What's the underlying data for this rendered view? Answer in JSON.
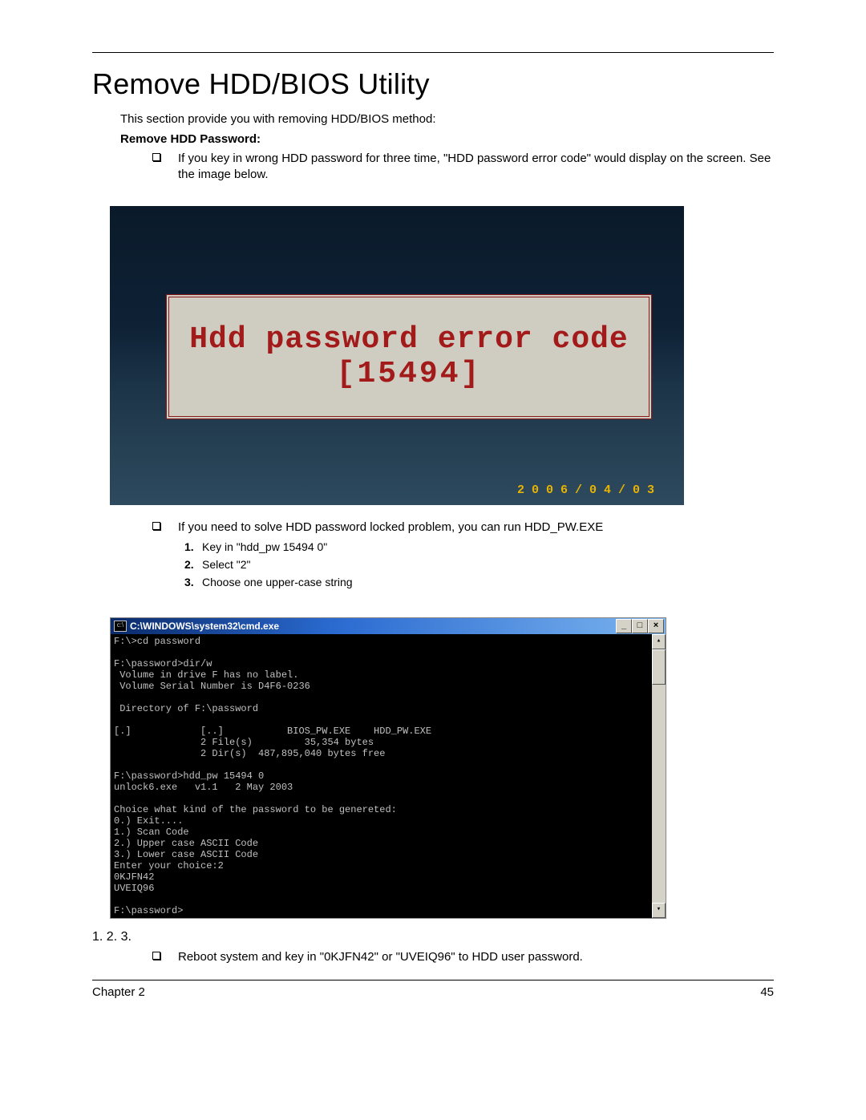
{
  "heading": "Remove HDD/BIOS Utility",
  "intro": "This section provide you with removing HDD/BIOS method:",
  "subhead": "Remove HDD Password:",
  "bullets": {
    "b1": "If you key in wrong HDD password for three time, \"HDD password error code\" would display on the screen. See the image below.",
    "b2": "If you need to solve HDD password locked problem, you can run HDD_PW.EXE",
    "b3": "Reboot system and key in \"0KJFN42\" or \"UVEIQ96\" to HDD user password."
  },
  "steps": {
    "s1": "Key in \"hdd_pw 15494 0\"",
    "s2": "Select \"2\"",
    "s3": "Choose one upper-case string"
  },
  "shot1": {
    "line1": "Hdd password error code",
    "line2": "[15494]",
    "datestamp": "2006/04/03"
  },
  "shot2": {
    "window_title": "C:\\WINDOWS\\system32\\cmd.exe",
    "icon_text": "c:\\",
    "min": "_",
    "max": "□",
    "close": "×",
    "scroll_up": "▴",
    "scroll_down": "▾",
    "term_text": "F:\\>cd password\n\nF:\\password>dir/w\n Volume in drive F has no label.\n Volume Serial Number is D4F6-0236\n\n Directory of F:\\password\n\n[.]            [..]           BIOS_PW.EXE    HDD_PW.EXE\n               2 File(s)         35,354 bytes\n               2 Dir(s)  487,895,040 bytes free\n\nF:\\password>hdd_pw 15494 0\nunlock6.exe   v1.1   2 May 2003\n\nChoice what kind of the password to be genereted:\n0.) Exit....\n1.) Scan Code\n2.) Upper case ASCII Code\n3.) Lower case ASCII Code\nEnter your choice:2\n0KJFN42\nUVEIQ96\n\nF:\\password>",
    "annot1": "1.",
    "annot2": "2.",
    "annot3": "3."
  },
  "footer": {
    "left": "Chapter 2",
    "right": "45"
  }
}
